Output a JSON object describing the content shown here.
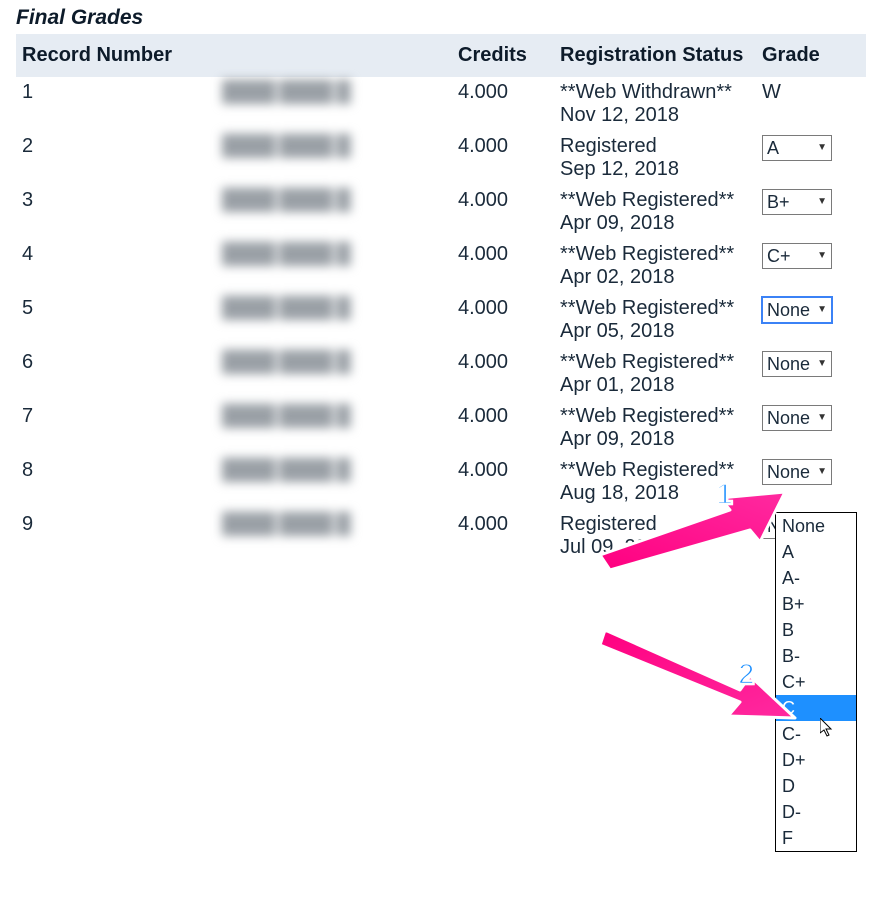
{
  "title": "Final Grades",
  "headers": {
    "record": "Record Number",
    "name": "",
    "credits": "Credits",
    "reg_status": "Registration Status",
    "grade": "Grade"
  },
  "rows": [
    {
      "num": "1",
      "credits": "4.000",
      "status": "**Web Withdrawn**\nNov 12, 2018",
      "grade_text": "W",
      "grade_select": null
    },
    {
      "num": "2",
      "credits": "4.000",
      "status": "Registered\nSep 12, 2018",
      "grade_text": null,
      "grade_select": "A"
    },
    {
      "num": "3",
      "credits": "4.000",
      "status": "**Web Registered**\nApr 09, 2018",
      "grade_text": null,
      "grade_select": "B+"
    },
    {
      "num": "4",
      "credits": "4.000",
      "status": "**Web Registered**\nApr 02, 2018",
      "grade_text": null,
      "grade_select": "C+"
    },
    {
      "num": "5",
      "credits": "4.000",
      "status": "**Web Registered**\nApr 05, 2018",
      "grade_text": null,
      "grade_select": "None",
      "open": true
    },
    {
      "num": "6",
      "credits": "4.000",
      "status": "**Web Registered**\nApr 01, 2018",
      "grade_text": null,
      "grade_select": "None"
    },
    {
      "num": "7",
      "credits": "4.000",
      "status": "**Web Registered**\nApr 09, 2018",
      "grade_text": null,
      "grade_select": "None"
    },
    {
      "num": "8",
      "credits": "4.000",
      "status": "**Web Registered**\nAug 18, 2018",
      "grade_text": null,
      "grade_select": "None"
    },
    {
      "num": "9",
      "credits": "4.000",
      "status": "Registered\nJul 09, 2018",
      "grade_text": null,
      "grade_select": "None"
    }
  ],
  "grade_options": [
    "None",
    "A",
    "A-",
    "B+",
    "B",
    "B-",
    "C+",
    "C",
    "C-",
    "D+",
    "D",
    "D-",
    "F"
  ],
  "dropdown_highlight": "C",
  "annotations": {
    "arrow1": "1",
    "arrow2": "2"
  }
}
